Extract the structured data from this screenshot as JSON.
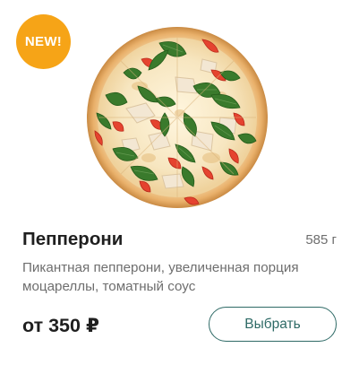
{
  "product": {
    "badge": "NEW!",
    "title": "Пепперони",
    "weight": "585 г",
    "description": "Пикантная пепперони, увеличенная порция моцареллы, томатный соус",
    "price": "от 350 ₽",
    "select_button": "Выбрать",
    "image": "pizza-photo"
  },
  "colors": {
    "badge": "#f6a417",
    "accent": "#2e6a66",
    "text": "#1f1f1f",
    "muted": "#6e6e6e"
  }
}
